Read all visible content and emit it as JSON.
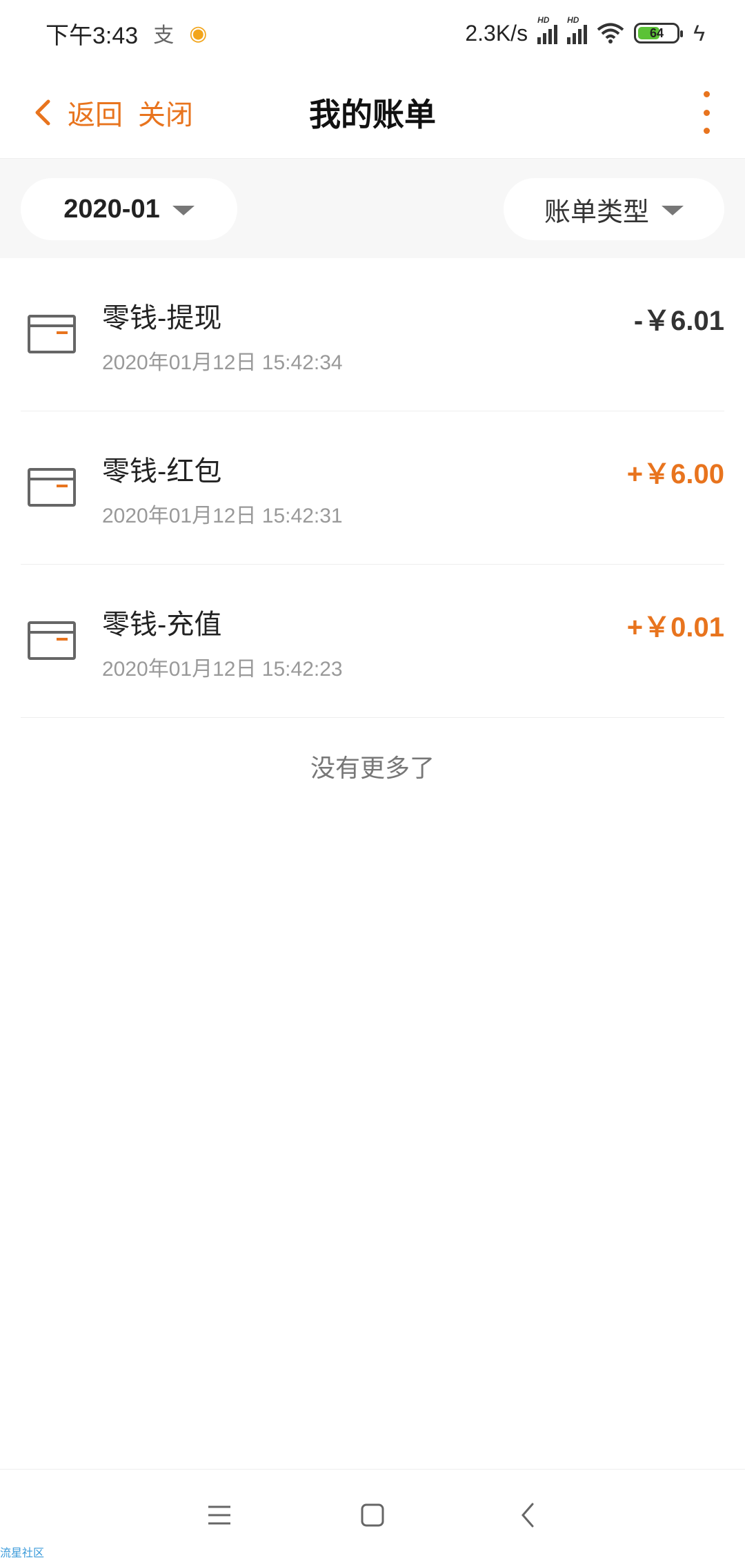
{
  "status_bar": {
    "time": "下午3:43",
    "net_speed": "2.3K/s",
    "hd_label": "HD",
    "battery": "64"
  },
  "nav": {
    "back_label": "返回",
    "close_label": "关闭",
    "title": "我的账单"
  },
  "filters": {
    "month": "2020-01",
    "type_label": "账单类型"
  },
  "records": [
    {
      "title": "零钱-提现",
      "time": "2020年01月12日 15:42:34",
      "amount": "-￥6.01"
    },
    {
      "title": "零钱-红包",
      "time": "2020年01月12日 15:42:31",
      "amount": "+￥6.00"
    },
    {
      "title": "零钱-充值",
      "time": "2020年01月12日 15:42:23",
      "amount": "+￥0.01"
    }
  ],
  "footer_text": "没有更多了",
  "watermark": "流星社区",
  "colors": {
    "accent": "#e8741e",
    "text": "#222222",
    "subtext": "#999999",
    "filter_bg": "#f7f7f7"
  }
}
